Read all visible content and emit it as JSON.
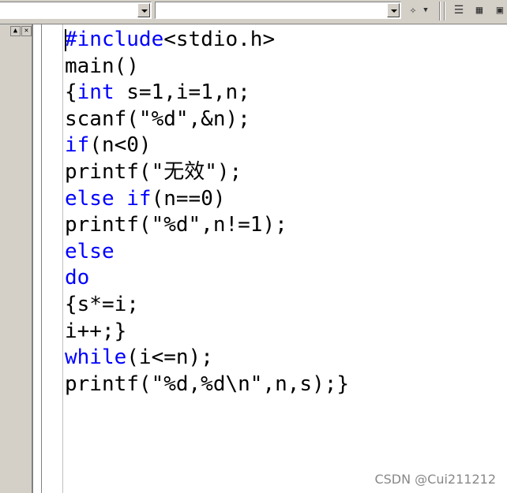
{
  "toolbar": {
    "icons": [
      "dropdown-arrow-icon",
      "dropdown-arrow-icon",
      "dropdown-arrow-icon",
      "magic-wand-icon",
      "stack-icon",
      "grid-icon"
    ]
  },
  "panel": {
    "buttons": [
      "▲",
      "✕"
    ]
  },
  "code": {
    "lines": [
      [
        {
          "t": "#include",
          "kw": true
        },
        {
          "t": "<stdio.h>",
          "kw": false
        }
      ],
      [
        {
          "t": "main()",
          "kw": false
        }
      ],
      [
        {
          "t": "{",
          "kw": false
        },
        {
          "t": "int",
          "kw": true
        },
        {
          "t": " s=1,i=1,n;",
          "kw": false
        }
      ],
      [
        {
          "t": "scanf(\"%d\",&n);",
          "kw": false
        }
      ],
      [
        {
          "t": "if",
          "kw": true
        },
        {
          "t": "(n<0)",
          "kw": false
        }
      ],
      [
        {
          "t": "printf(\"无效\");",
          "kw": false
        }
      ],
      [
        {
          "t": "else if",
          "kw": true
        },
        {
          "t": "(n==0)",
          "kw": false
        }
      ],
      [
        {
          "t": "printf(\"%d\",n!=1);",
          "kw": false
        }
      ],
      [
        {
          "t": "else",
          "kw": true
        }
      ],
      [
        {
          "t": "do",
          "kw": true
        }
      ],
      [
        {
          "t": "{s*=i;",
          "kw": false
        }
      ],
      [
        {
          "t": "i++;}",
          "kw": false
        }
      ],
      [
        {
          "t": "while",
          "kw": true
        },
        {
          "t": "(i<=n);",
          "kw": false
        }
      ],
      [
        {
          "t": "printf(\"%d,%d\\n\",n,s);}",
          "kw": false
        }
      ]
    ]
  },
  "watermark": "CSDN @Cui211212"
}
